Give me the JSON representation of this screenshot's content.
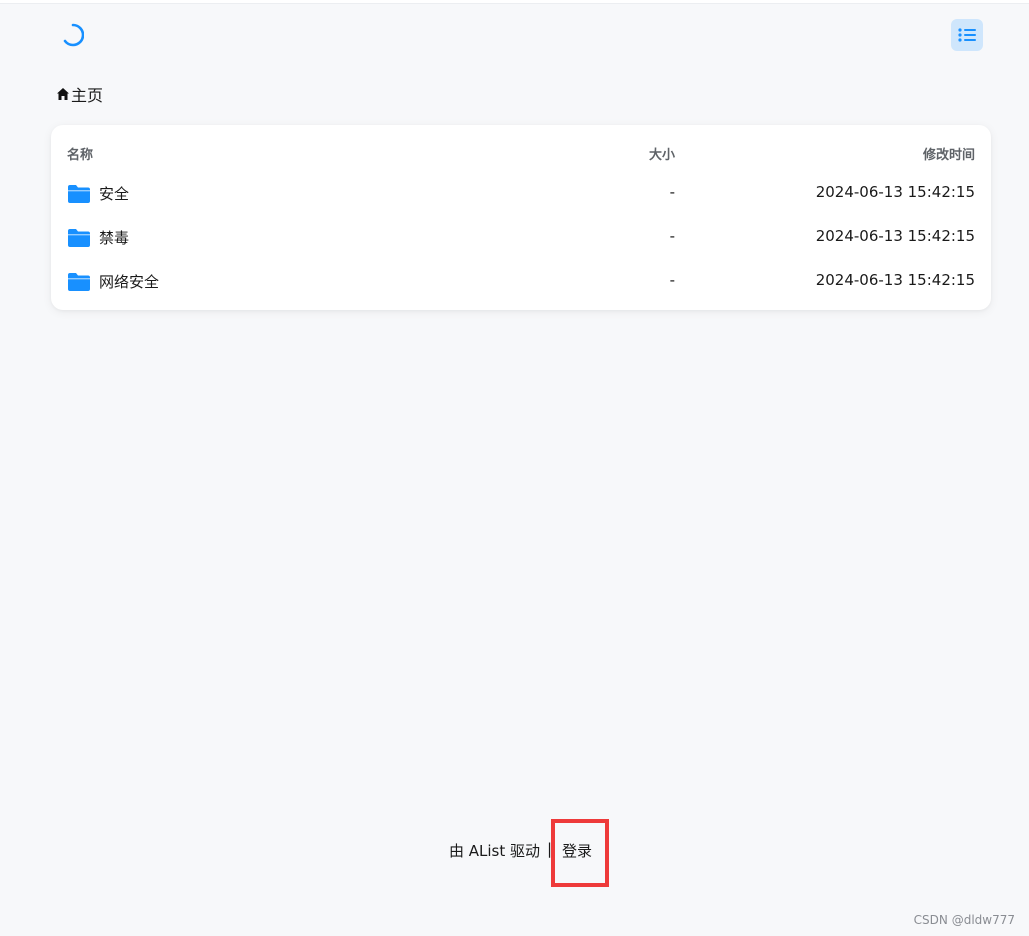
{
  "breadcrumb": {
    "home_label": "主页"
  },
  "table": {
    "columns": {
      "name": "名称",
      "size": "大小",
      "modified": "修改时间"
    },
    "rows": [
      {
        "name": "安全",
        "size": "-",
        "modified": "2024-06-13 15:42:15"
      },
      {
        "name": "禁毒",
        "size": "-",
        "modified": "2024-06-13 15:42:15"
      },
      {
        "name": "网络安全",
        "size": "-",
        "modified": "2024-06-13 15:42:15"
      }
    ]
  },
  "footer": {
    "powered_by": "由 AList 驱动",
    "divider": "|",
    "login_label": "登录"
  },
  "watermark": "CSDN @dldw777",
  "icons": {
    "logo": "loading-spinner-icon",
    "layout_toggle": "list-view-icon",
    "home": "home-icon",
    "folder": "folder-icon"
  },
  "colors": {
    "accent": "#1890ff",
    "toggle_bg": "#cfe6fc",
    "highlight": "#ee3a3a"
  }
}
